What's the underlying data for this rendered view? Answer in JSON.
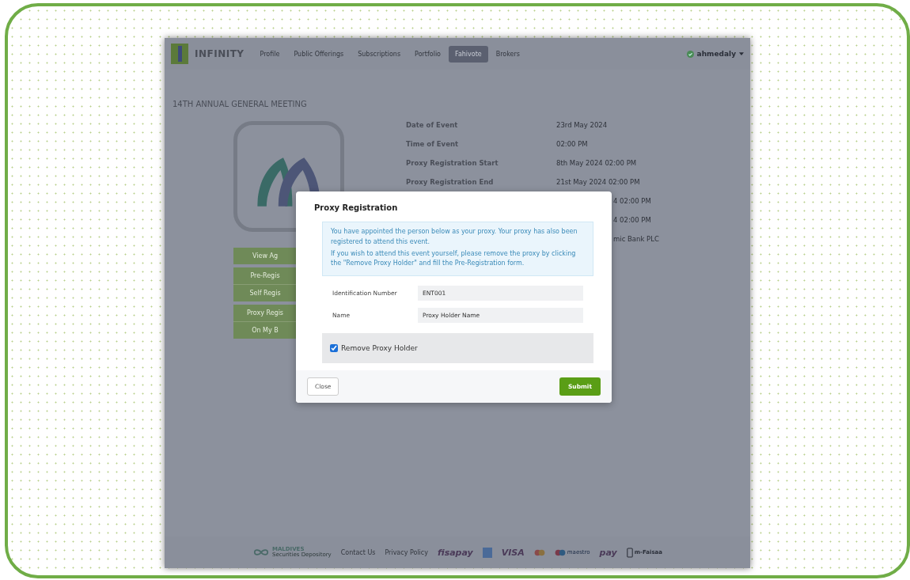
{
  "navbar": {
    "brand": "INFINITY",
    "links": [
      {
        "label": "Profile",
        "selected": false
      },
      {
        "label": "Public Offerings",
        "selected": false
      },
      {
        "label": "Subscriptions",
        "selected": false
      },
      {
        "label": "Portfolio",
        "selected": false
      },
      {
        "label": "Fahivote",
        "selected": true
      },
      {
        "label": "Brokers",
        "selected": false
      }
    ],
    "user": "ahmedaly"
  },
  "event": {
    "title": "14TH ANNUAL GENERAL MEETING",
    "details": [
      {
        "label": "Date of Event",
        "value": "23rd May 2024"
      },
      {
        "label": "Time of Event",
        "value": "02:00 PM"
      },
      {
        "label": "Proxy Registration Start",
        "value": "8th May 2024 02:00 PM"
      },
      {
        "label": "Proxy Registration End",
        "value": "21st May 2024 02:00 PM"
      }
    ],
    "details_partial": [
      "4 02:00 PM",
      "4 02:00 PM",
      "mic Bank PLC"
    ],
    "actions": [
      {
        "lines": [
          "View Ag"
        ]
      },
      {
        "lines": [
          "Pre-Regis",
          "Self Regis"
        ]
      },
      {
        "lines": [
          "Proxy Regis",
          "On My B"
        ]
      }
    ]
  },
  "modal": {
    "title": "Proxy Registration",
    "notice": [
      "You have appointed the person below as your proxy. Your proxy has also been registered to attend this event.",
      "If you wish to attend this event yourself, please remove the proxy by clicking the \"Remove Proxy Holder\" and fill the Pre-Registration form."
    ],
    "fields": [
      {
        "label": "Identification Number",
        "value": "ENT001"
      },
      {
        "label": "Name",
        "value": "Proxy Holder Name"
      }
    ],
    "checkbox": {
      "label": "Remove Proxy Holder",
      "checked": true
    },
    "close": "Close",
    "submit": "Submit"
  },
  "footer": [
    {
      "kind": "brand",
      "title": "MALDIVES",
      "subtitle": "Securities Depository"
    },
    {
      "kind": "link",
      "text": "Contact Us"
    },
    {
      "kind": "link",
      "text": "Privacy Policy"
    },
    {
      "kind": "logo",
      "text": "fisapay"
    },
    {
      "kind": "card"
    },
    {
      "kind": "logo",
      "text": "VISA"
    },
    {
      "kind": "mastercard"
    },
    {
      "kind": "maestro",
      "text": "maestro"
    },
    {
      "kind": "logo",
      "text": "pay"
    },
    {
      "kind": "phone",
      "text": "m-Faisaa"
    }
  ]
}
